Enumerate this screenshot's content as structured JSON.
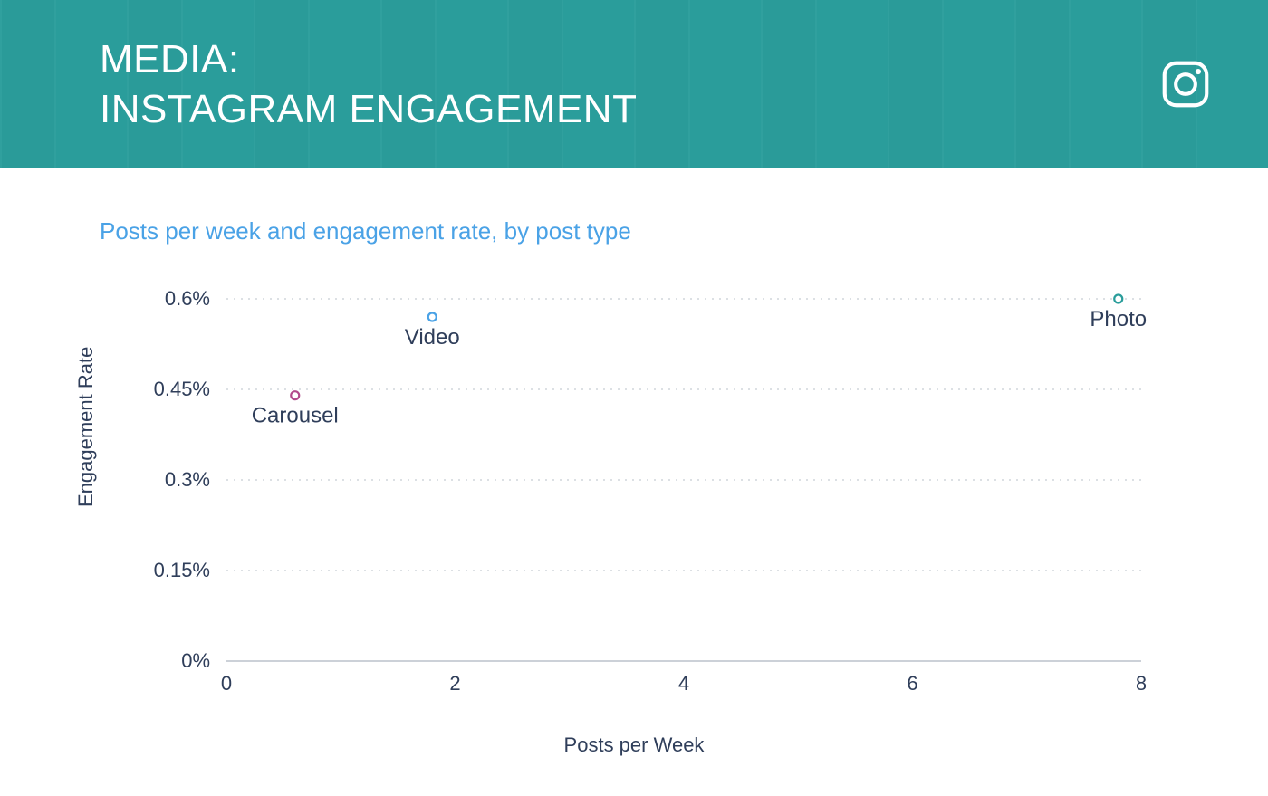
{
  "header": {
    "line1": "MEDIA:",
    "line2": "INSTAGRAM ENGAGEMENT"
  },
  "subtitle": "Posts per week and engagement rate, by post type",
  "chart_data": {
    "type": "scatter",
    "title": "Posts per week and engagement rate, by post type",
    "xlabel": "Posts per Week",
    "ylabel": "Engagement Rate",
    "xlim": [
      0,
      8
    ],
    "ylim": [
      0,
      0.006
    ],
    "xticks": [
      0,
      2,
      4,
      6,
      8
    ],
    "yticks": [
      0,
      0.0015,
      0.003,
      0.0045,
      0.006
    ],
    "ytick_labels": [
      "0%",
      "0.15%",
      "0.3%",
      "0.45%",
      "0.6%"
    ],
    "series": [
      {
        "name": "Carousel",
        "x": 0.6,
        "y": 0.0044,
        "color": "#b24a8b"
      },
      {
        "name": "Video",
        "x": 1.8,
        "y": 0.0057,
        "color": "#4aa2e6"
      },
      {
        "name": "Photo",
        "x": 7.8,
        "y": 0.006,
        "color": "#2a9d9b"
      }
    ]
  }
}
